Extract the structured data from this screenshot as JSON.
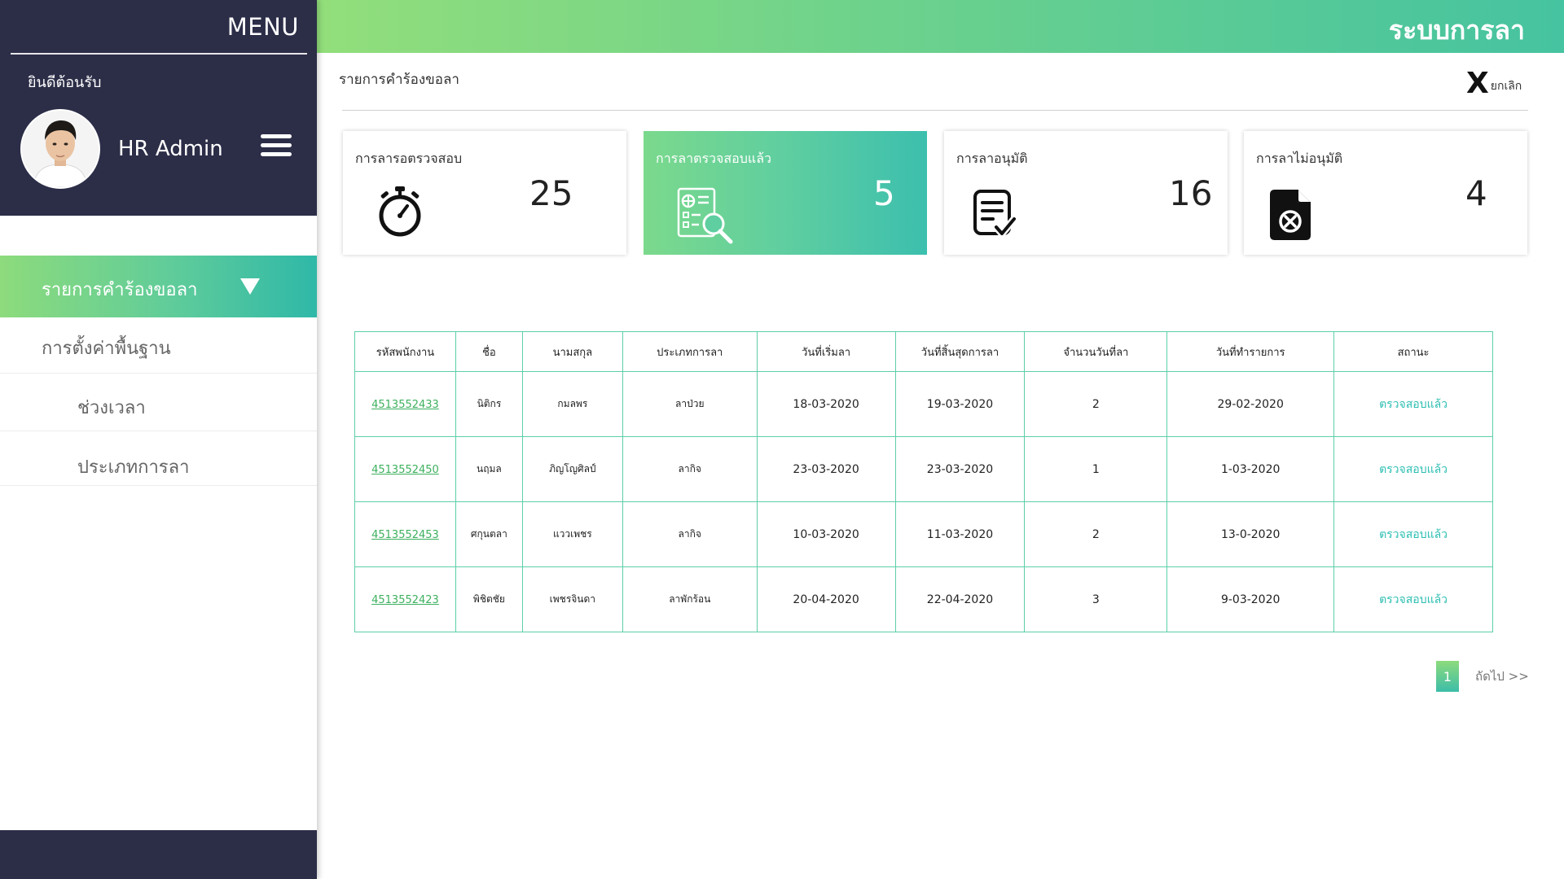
{
  "sidebar": {
    "menu_title": "MENU",
    "welcome": "ยินดีต้อนรับ",
    "user_name": "HR Admin",
    "active_item": "รายการคำร้องขอลา",
    "items": [
      {
        "label": "การตั้งค่าพื้นฐาน"
      },
      {
        "label": "ช่วงเวลา"
      },
      {
        "label": "ประเภทการลา"
      }
    ]
  },
  "header": {
    "app_title": "ระบบการลา",
    "page_title": "รายการคำร้องขอลา",
    "cancel_label": "ยกเลิก",
    "cancel_glyph": "X"
  },
  "cards": [
    {
      "title": "การลารอตรวจสอบ",
      "count": "25",
      "icon": "stopwatch-icon"
    },
    {
      "title": "การลาตรวจสอบแล้ว",
      "count": "5",
      "icon": "document-search-icon"
    },
    {
      "title": "การลาอนุมัติ",
      "count": "16",
      "icon": "document-check-icon"
    },
    {
      "title": "การลาไม่อนุมัติ",
      "count": "4",
      "icon": "file-x-icon"
    }
  ],
  "table": {
    "headers": [
      "รหัสพนักงาน",
      "ชื่อ",
      "นามสกุล",
      "ประเภทการลา",
      "วันที่เริ่มลา",
      "วันที่สิ้นสุดการลา",
      "จำนวนวันที่ลา",
      "วันที่ทำรายการ",
      "สถานะ"
    ],
    "rows": [
      {
        "id": "4513552433",
        "first": "นิติกร",
        "last": "กมลพร",
        "type": "ลาป่วย",
        "start": "18-03-2020",
        "end": "19-03-2020",
        "days": "2",
        "created": "29-02-2020",
        "status": "ตรวจสอบแล้ว"
      },
      {
        "id": "4513552450",
        "first": "นฤมล",
        "last": "ภิญโญศิลป์",
        "type": "ลากิจ",
        "start": "23-03-2020",
        "end": "23-03-2020",
        "days": "1",
        "created": "1-03-2020",
        "status": "ตรวจสอบแล้ว"
      },
      {
        "id": "4513552453",
        "first": "ศกุนตลา",
        "last": "แววเพชร",
        "type": "ลากิจ",
        "start": "10-03-2020",
        "end": "11-03-2020",
        "days": "2",
        "created": "13-0-2020",
        "status": "ตรวจสอบแล้ว"
      },
      {
        "id": "4513552423",
        "first": "พิชิตชัย",
        "last": "เพชรจินดา",
        "type": "ลาพักร้อน",
        "start": "20-04-2020",
        "end": "22-04-2020",
        "days": "3",
        "created": "9-03-2020",
        "status": "ตรวจสอบแล้ว"
      }
    ]
  },
  "pagination": {
    "current": "1",
    "next_label": "ถัดไป >>"
  },
  "colors": {
    "sidebar_dark": "#2c2e48",
    "gradient_start": "#8ddb7c",
    "gradient_end": "#2fb8a8",
    "table_border": "#5dcfa8",
    "link_green": "#3db05e",
    "status_teal": "#2dbfb2"
  }
}
